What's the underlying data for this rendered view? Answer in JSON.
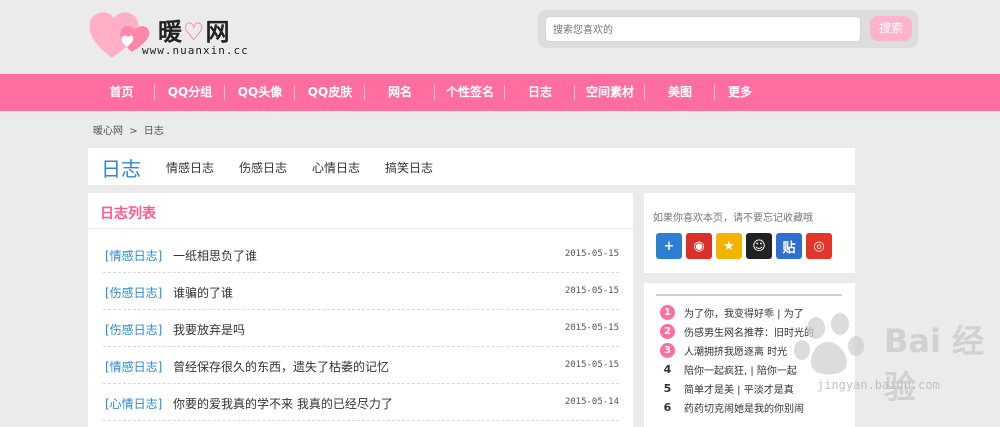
{
  "site": {
    "logo_prefix": "暖",
    "logo_heart": "♡",
    "logo_suffix": "网",
    "domain": "www.nuanxin.cc"
  },
  "search": {
    "placeholder": "搜索您喜欢的",
    "button": "搜索"
  },
  "nav": {
    "items": [
      {
        "label": "首页",
        "width": 67
      },
      {
        "label": "QQ分组",
        "width": 70
      },
      {
        "label": "QQ头像",
        "width": 70
      },
      {
        "label": "QQ皮肤",
        "width": 70
      },
      {
        "label": "网名",
        "width": 70
      },
      {
        "label": "个性签名",
        "width": 70
      },
      {
        "label": "日志",
        "width": 70
      },
      {
        "label": "空间素材",
        "width": 70
      },
      {
        "label": "美图",
        "width": 70
      },
      {
        "label": "更多",
        "width": 50
      }
    ]
  },
  "breadcrumb": {
    "home": "暖心网",
    "separator": ">",
    "current": "日志"
  },
  "category": {
    "title": "日志",
    "tabs": [
      "情感日志",
      "伤感日志",
      "心情日志",
      "搞笑日志"
    ]
  },
  "list": {
    "title": "日志列表",
    "rows": [
      {
        "category": "[情感日志]",
        "title": "一纸相思负了谁",
        "date": "2015-05-15"
      },
      {
        "category": "[伤感日志]",
        "title": "谁骗的了谁",
        "date": "2015-05-15"
      },
      {
        "category": "[伤感日志]",
        "title": "我要放弃是吗",
        "date": "2015-05-15"
      },
      {
        "category": "[情感日志]",
        "title": "曾经保存很久的东西，遗失了枯萎的记忆",
        "date": "2015-05-15"
      },
      {
        "category": "[心情日志]",
        "title": "你要的爱我真的学不来 我真的已经尽力了",
        "date": "2015-05-14"
      }
    ]
  },
  "share": {
    "text": "如果你喜欢本页，请不要忘记收藏哦",
    "icons": [
      {
        "name": "add-more-icon",
        "glyph": "+",
        "color": "#2d7fd1"
      },
      {
        "name": "qq-space-icon",
        "glyph": "◉",
        "color": "#d9302c"
      },
      {
        "name": "qzone-icon",
        "glyph": "★",
        "color": "#f2b400"
      },
      {
        "name": "qq-icon",
        "glyph": "☺",
        "color": "#222222"
      },
      {
        "name": "tieba-icon",
        "glyph": "贴",
        "color": "#2f6fd4"
      },
      {
        "name": "weibo-icon",
        "glyph": "◎",
        "color": "#e2352b"
      }
    ]
  },
  "hot": {
    "items": [
      {
        "num": "1",
        "text": "为了你，我变得好乖 | 为了",
        "highlight": true
      },
      {
        "num": "2",
        "text": "伤感男生网名推荐：旧时光的",
        "highlight": true
      },
      {
        "num": "3",
        "text": "人潮拥挤我愿逐离 时光",
        "highlight": true
      },
      {
        "num": "4",
        "text": "陪你一起疯狂, | 陪你一起",
        "highlight": false
      },
      {
        "num": "5",
        "text": "简单才是美 | 平淡才是真",
        "highlight": false
      },
      {
        "num": "6",
        "text": "药药切克闹她是我的你别闹",
        "highlight": false
      }
    ]
  },
  "watermark": {
    "text": "Bai 经验",
    "url": "jingyan.baidu.com"
  }
}
